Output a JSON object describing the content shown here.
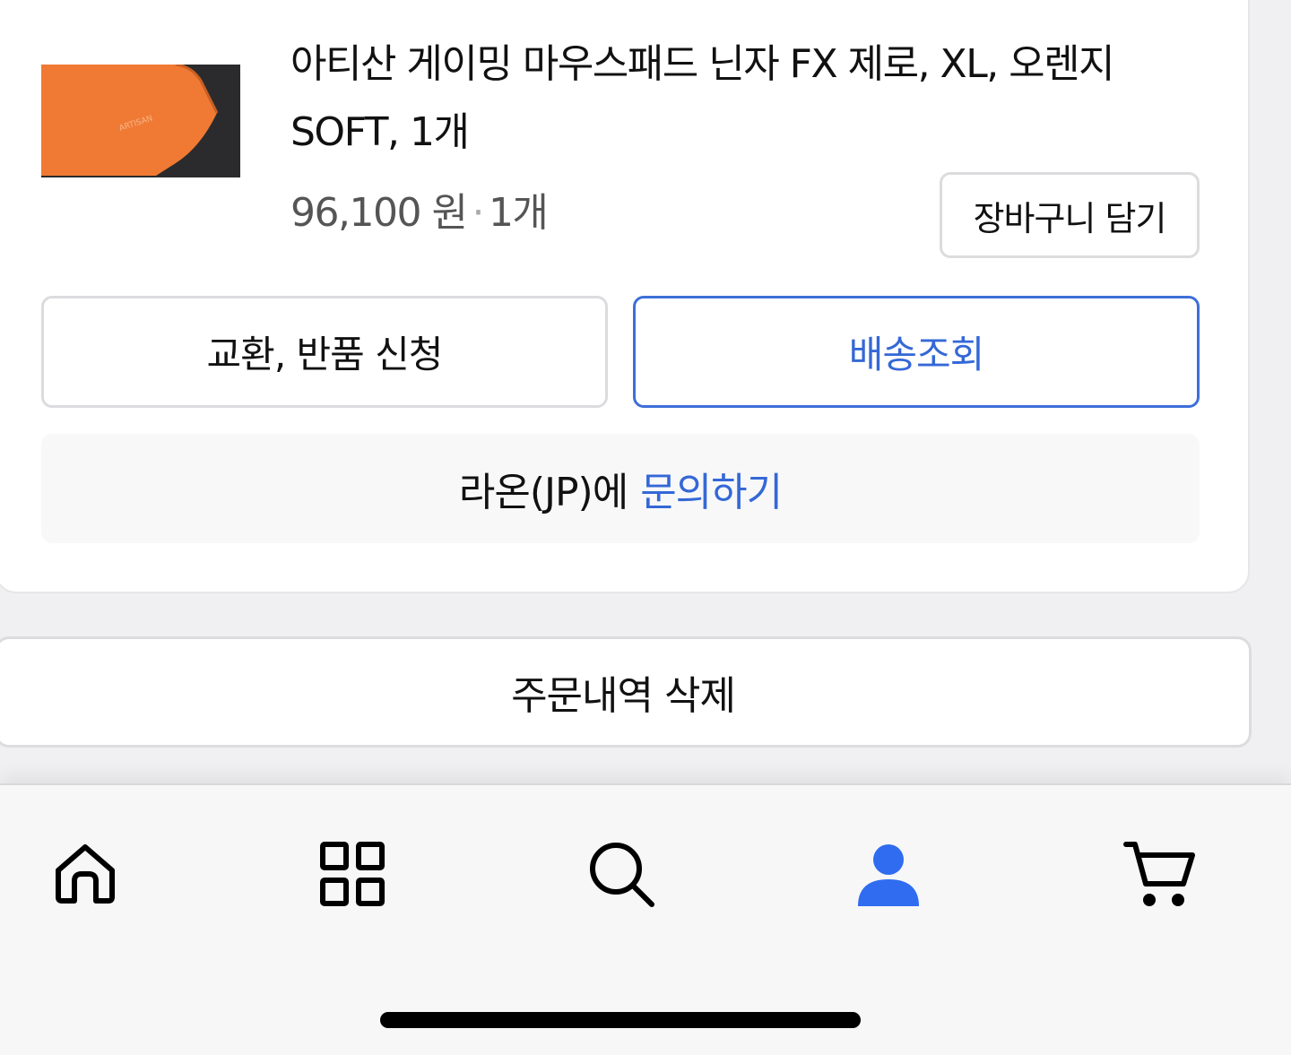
{
  "order_item": {
    "product_name_line1": "아티산 게이밍 마우스패드 닌자 FX 제로, XL, 오렌지",
    "product_name_line2": "SOFT, 1개",
    "price": "96,100 원",
    "separator": "·",
    "quantity": "1개",
    "add_to_cart_label": "장바구니 담기",
    "exchange_return_label": "교환, 반품 신청",
    "delivery_tracking_label": "배송조회",
    "inquiry_seller": "라온(JP)에",
    "inquiry_link": "문의하기"
  },
  "delete_order_label": "주문내역 삭제",
  "tab_bar": {
    "items": [
      {
        "icon": "home-icon",
        "active": false
      },
      {
        "icon": "categories-icon",
        "active": false
      },
      {
        "icon": "search-icon",
        "active": false
      },
      {
        "icon": "user-icon",
        "active": true
      },
      {
        "icon": "cart-icon",
        "active": false
      }
    ]
  },
  "colors": {
    "accent": "#3468d6",
    "active_tab": "#2f6cf0",
    "product_orange": "#f07a34"
  }
}
